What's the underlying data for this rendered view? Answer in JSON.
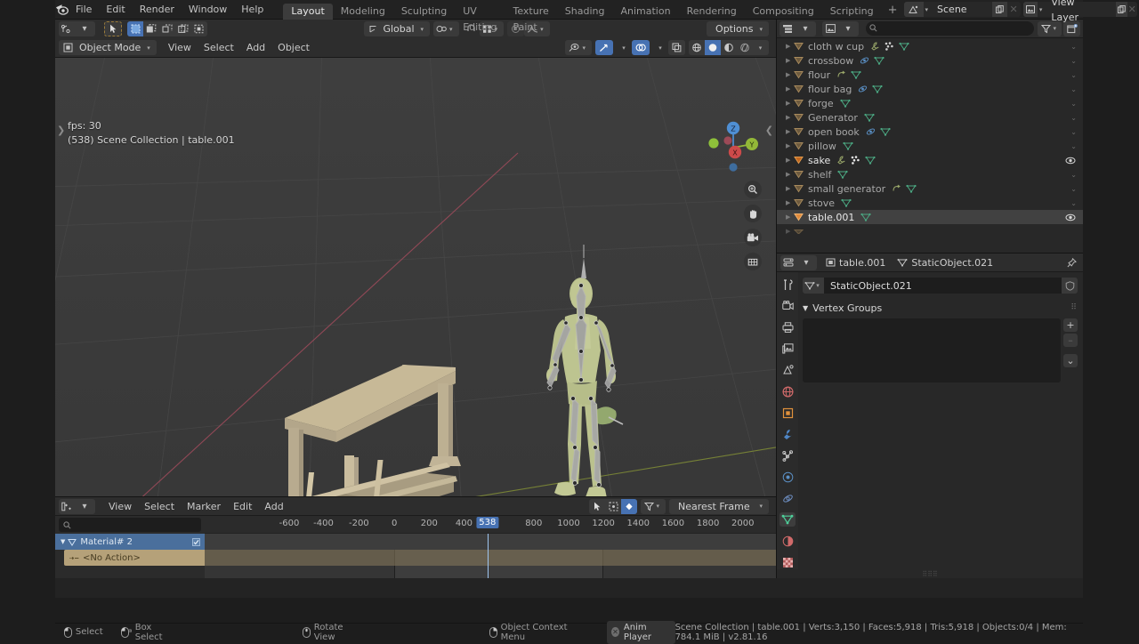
{
  "topbar": {
    "logo_icon": "blender-logo-icon",
    "menus": [
      "File",
      "Edit",
      "Render",
      "Window",
      "Help"
    ],
    "tabs": [
      "Layout",
      "Modeling",
      "Sculpting",
      "UV Editing",
      "Texture Paint",
      "Shading",
      "Animation",
      "Rendering",
      "Compositing",
      "Scripting"
    ],
    "active_tab": "Layout",
    "add_tab_label": "+",
    "scene_name": "Scene",
    "view_layer_name": "View Layer",
    "scene_icon": "scene-icon",
    "view_layer_icon": "image-layer-icon",
    "copy_icon": "duplicate-icon",
    "close_icon": "close-icon"
  },
  "viewport_header": {
    "editor_type_icon": "editor-type-icon",
    "cursor_tool_icon": "select-box-tool-icon",
    "select_modes": [
      "set",
      "extend",
      "subtract",
      "invert",
      "intersect"
    ],
    "orientation_label": "Global",
    "orientation_icon": "orientation-icon",
    "pivot_icon": "pivot-point-icon",
    "snap_icon": "snap-magnet-icon",
    "snap_to_icon": "snap-increment-icon",
    "proportional_icon": "proportional-edit-icon",
    "falloff_icon": "falloff-curve-icon",
    "options_label": "Options",
    "mode_label": "Object Mode",
    "mode_icon": "object-mode-icon",
    "menus": [
      "View",
      "Select",
      "Add",
      "Object"
    ],
    "visibility_icon": "visibility-eye-icon",
    "gizmo_icon": "gizmo-icon",
    "overlays_icon": "overlays-icon",
    "xray_icon": "xray-toggle-icon",
    "shading_modes": [
      "wireframe",
      "solid",
      "material-preview",
      "rendered"
    ],
    "active_shading": "solid"
  },
  "viewport": {
    "fps_text": "fps: 30",
    "scene_text": "(538) Scene Collection | table.001",
    "gizmo_axes": [
      {
        "label": "Z",
        "color": "#4f8fd4"
      },
      {
        "label": "Y",
        "color": "#93b838"
      },
      {
        "label": "X",
        "color": "#cc4a4a"
      }
    ],
    "nav_buttons": [
      "zoom-icon",
      "hand-pan-icon",
      "camera-view-icon",
      "perspective-toggle-icon"
    ],
    "background_color": "#3b3b3b",
    "grid_color": "#4a4a4a",
    "x_axis_color": "#9a4a5a",
    "y_axis_color": "#7a8a3a",
    "table_color": "#c3b596",
    "character_color": "#b8bf8a",
    "armature_color": "#a8a8a8"
  },
  "dopesheet": {
    "editor_icon": "dopesheet-icon",
    "menus": [
      "View",
      "Select",
      "Marker",
      "Edit",
      "Add"
    ],
    "cursor_icon": "arrow-select-icon",
    "box_icon": "box-select-icon",
    "key_icon": "keyframe-icon",
    "filter_icon": "filter-funnel-icon",
    "snap_label": "Nearest Frame",
    "search_placeholder": "",
    "search_icon": "search-icon",
    "channels": [
      {
        "label": "Material# 2",
        "type": "selected",
        "icon": "mesh-data-icon",
        "checkbox": true
      },
      {
        "label": "<No Action>",
        "type": "action",
        "icon": "action-icon"
      }
    ],
    "ruler_ticks": [
      -600,
      -400,
      -200,
      0,
      200,
      400,
      800,
      1000,
      1200,
      1400,
      1600,
      1800,
      2000
    ],
    "current_frame": 538,
    "range_start": 0,
    "range_end": 1200
  },
  "outliner": {
    "display_mode_icon": "view-layer-icon",
    "search_placeholder": "",
    "search_icon": "search-icon",
    "filter_icon": "filter-funnel-icon",
    "new_collection_icon": "new-collection-icon",
    "items": [
      {
        "name": "cloth w cup",
        "icons": [
          "modifier-icon",
          "particles-icon",
          "mesh-data-icon"
        ],
        "active": false,
        "visible": false
      },
      {
        "name": "crossbow",
        "icons": [
          "physics-icon",
          "mesh-data-icon"
        ],
        "active": false,
        "visible": false
      },
      {
        "name": "flour",
        "icons": [
          "constraint-icon",
          "mesh-data-icon"
        ],
        "active": false,
        "visible": false
      },
      {
        "name": "flour bag",
        "icons": [
          "physics-icon",
          "mesh-data-icon"
        ],
        "active": false,
        "visible": false
      },
      {
        "name": "forge",
        "icons": [
          "mesh-data-icon"
        ],
        "active": false,
        "visible": false
      },
      {
        "name": "Generator",
        "icons": [
          "mesh-data-icon"
        ],
        "active": false,
        "visible": false
      },
      {
        "name": "open book",
        "icons": [
          "physics-icon",
          "mesh-data-icon"
        ],
        "active": false,
        "visible": false
      },
      {
        "name": "pillow",
        "icons": [
          "mesh-data-icon"
        ],
        "active": false,
        "visible": false
      },
      {
        "name": "sake",
        "icons": [
          "modifier-icon",
          "particles-icon",
          "mesh-data-icon"
        ],
        "active": false,
        "visible": true
      },
      {
        "name": "shelf",
        "icons": [
          "mesh-data-icon"
        ],
        "active": false,
        "visible": false
      },
      {
        "name": "small generator",
        "icons": [
          "constraint-icon",
          "mesh-data-icon"
        ],
        "active": false,
        "visible": false
      },
      {
        "name": "stove",
        "icons": [
          "mesh-data-icon"
        ],
        "active": false,
        "visible": false
      },
      {
        "name": "table.001",
        "icons": [
          "mesh-data-icon"
        ],
        "active": true,
        "visible": true
      }
    ]
  },
  "properties": {
    "editor_icon": "properties-editor-icon",
    "breadcrumb_object": "table.001",
    "breadcrumb_data": "StaticObject.021",
    "object_icon": "object-icon",
    "data_icon": "mesh-data-icon",
    "pin_icon": "pin-icon",
    "id_name": "StaticObject.021",
    "shield_icon": "fake-user-shield-icon",
    "panel_title": "Vertex Groups",
    "add_label": "+",
    "remove_label": "–",
    "menu_label": "⌄",
    "tabs": [
      {
        "name": "tool-tab",
        "icon": "tool-icon",
        "active": false
      },
      {
        "name": "render-tab",
        "icon": "render-camera-icon",
        "active": false
      },
      {
        "name": "output-tab",
        "icon": "printer-output-icon",
        "active": false
      },
      {
        "name": "view-layer-tab",
        "icon": "images-layer-icon",
        "active": false
      },
      {
        "name": "scene-tab",
        "icon": "scene-cone-icon",
        "active": false
      },
      {
        "name": "world-tab",
        "icon": "world-globe-icon",
        "active": false
      },
      {
        "name": "object-tab",
        "icon": "object-square-icon",
        "active": false
      },
      {
        "name": "modifier-tab",
        "icon": "wrench-icon",
        "active": false
      },
      {
        "name": "particles-tab",
        "icon": "particles-icon",
        "active": false
      },
      {
        "name": "physics-tab",
        "icon": "physics-orbit-icon",
        "active": false
      },
      {
        "name": "constraints-tab",
        "icon": "constraint-icon",
        "active": false
      },
      {
        "name": "data-tab",
        "icon": "mesh-data-triangle-icon",
        "active": true
      },
      {
        "name": "material-tab",
        "icon": "material-sphere-icon",
        "active": false
      },
      {
        "name": "texture-tab",
        "icon": "texture-checker-icon",
        "active": false
      }
    ]
  },
  "statusbar": {
    "items": [
      {
        "label": "Select",
        "icon": "mouse-left-icon"
      },
      {
        "label": "Box Select",
        "icon": "mouse-left-drag-icon"
      },
      {
        "label": "Rotate View",
        "icon": "mouse-middle-icon"
      },
      {
        "label": "Object Context Menu",
        "icon": "mouse-right-icon"
      }
    ],
    "anim_player_label": "Anim Player",
    "anim_player_icon": "cancel-x-icon",
    "stats": "Scene Collection | table.001 | Verts:3,150 | Faces:5,918 | Tris:5,918 | Objects:0/4 | Mem: 784.1 MiB | v2.81.16"
  }
}
